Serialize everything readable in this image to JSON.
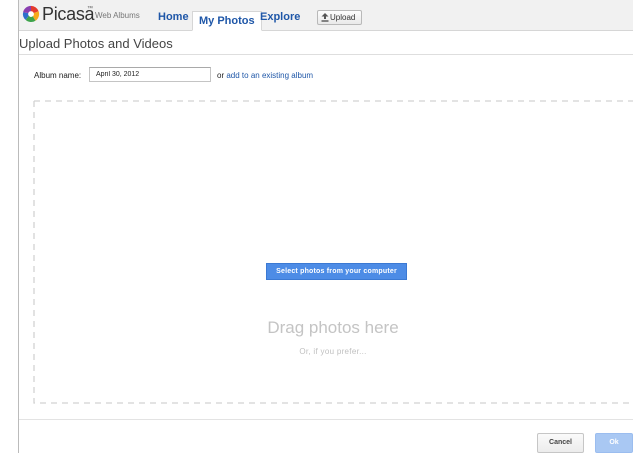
{
  "header": {
    "logo_text": "Picasa",
    "logo_tm": "™",
    "logo_sub": "Web Albums",
    "tabs": [
      {
        "label": "Home"
      },
      {
        "label": "My Photos"
      },
      {
        "label": "Explore"
      }
    ],
    "upload_label": "Upload"
  },
  "page": {
    "title": "Upload Photos and Videos"
  },
  "album": {
    "label": "Album name:",
    "value": "April 30, 2012",
    "or_text": "or",
    "link_text": "add to an existing album"
  },
  "dropzone": {
    "title": "Drag photos here",
    "subtitle": "Or, if you prefer...",
    "select_label": "Select photos from your computer"
  },
  "footer": {
    "cancel_label": "Cancel",
    "ok_label": "Ok"
  },
  "colors": {
    "accent": "#4d8ce6",
    "link": "#1f57a8",
    "ok_disabled": "#a9c8f3"
  }
}
